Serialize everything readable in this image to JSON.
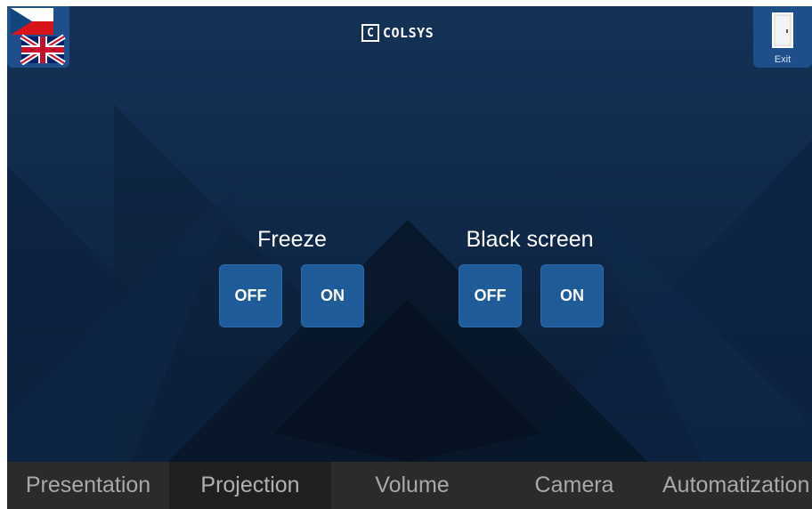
{
  "header": {
    "logo_mark": "C",
    "logo_text": "COLSYS",
    "exit_label": "Exit"
  },
  "groups": [
    {
      "label": "Freeze",
      "buttons": [
        "OFF",
        "ON"
      ]
    },
    {
      "label": "Black screen",
      "buttons": [
        "OFF",
        "ON"
      ]
    }
  ],
  "tabs": [
    {
      "label": "Presentation"
    },
    {
      "label": "Projection",
      "active": true
    },
    {
      "label": "Volume"
    },
    {
      "label": "Camera"
    },
    {
      "label": "Automatization"
    }
  ],
  "colors": {
    "background": "#10294a",
    "button": "#1f5a99",
    "tabbar": "#2b2b2b",
    "tab_active": "#202020"
  },
  "icons": {
    "language": "flag-cz-uk-icon",
    "exit": "door-icon"
  }
}
